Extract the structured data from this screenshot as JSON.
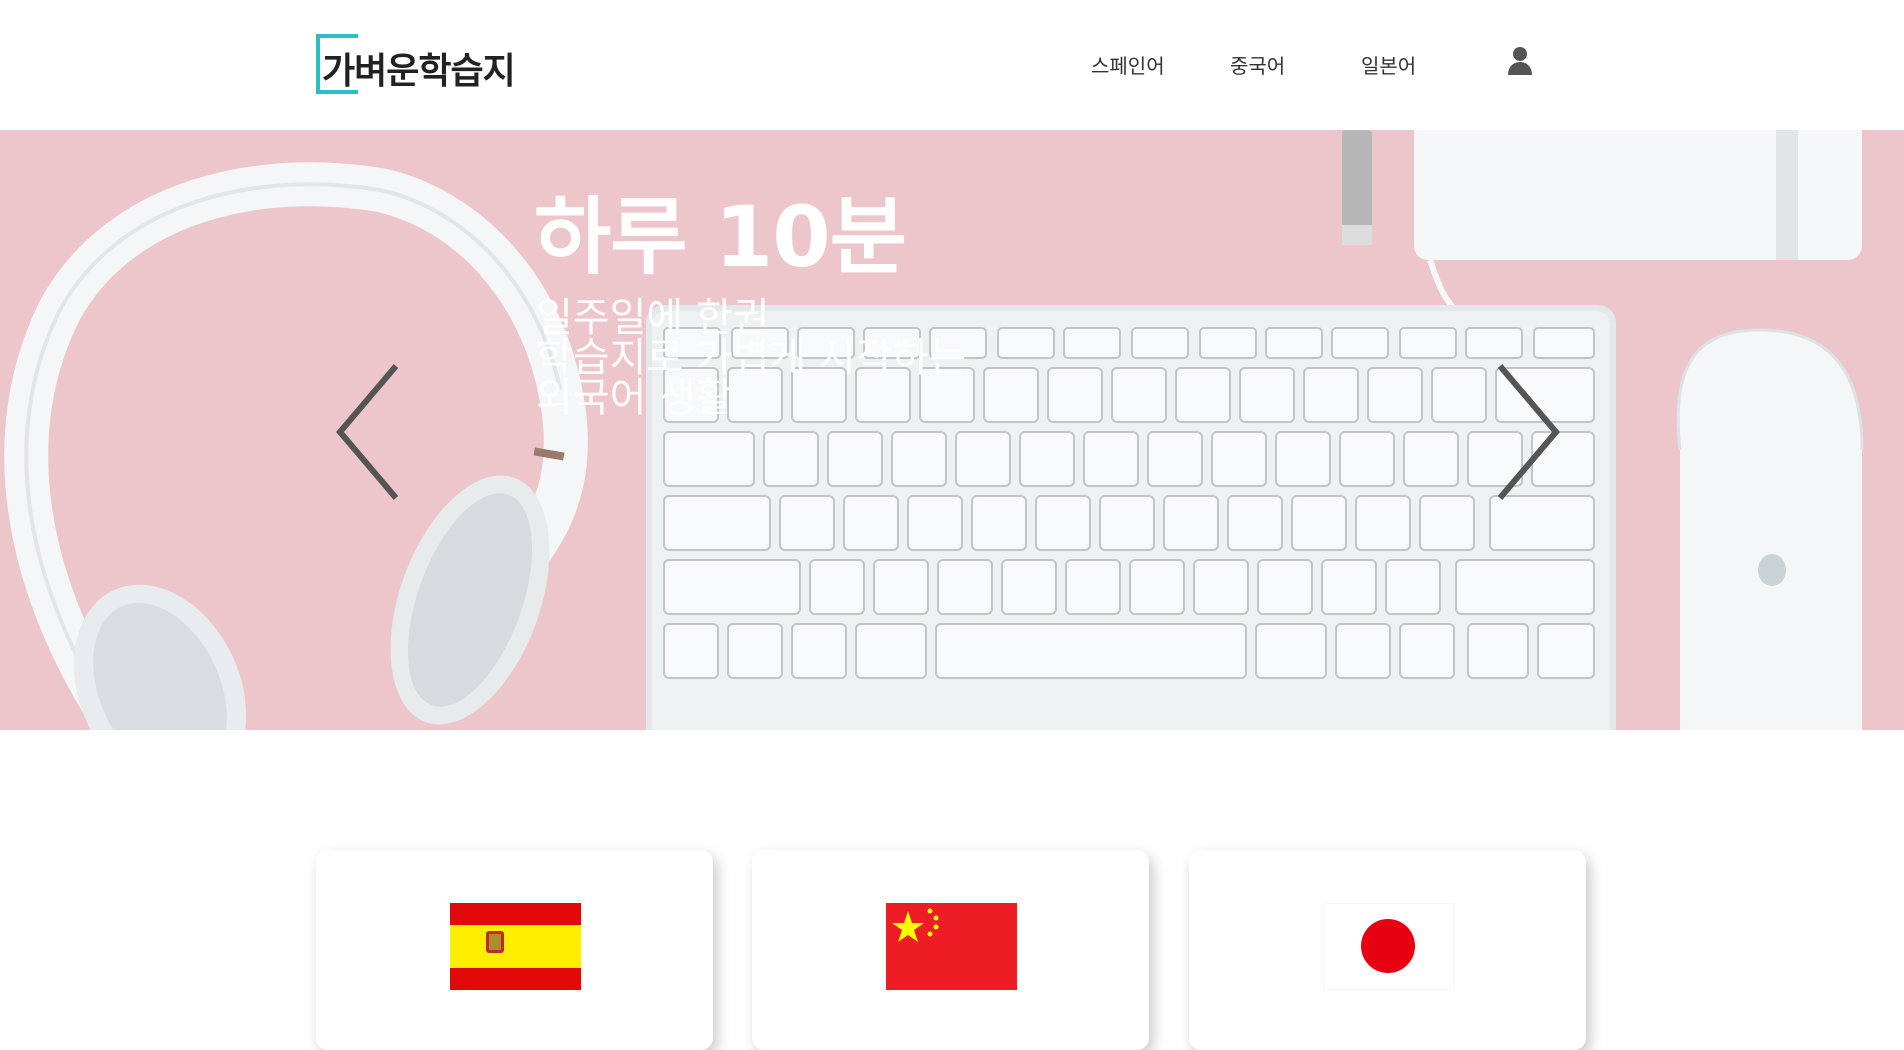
{
  "header": {
    "logo": "가벼운학습지",
    "nav": [
      "스페인어",
      "중국어",
      "일본어"
    ],
    "user_icon": "user-icon"
  },
  "hero": {
    "title": "하루 10분",
    "subtitle_lines": [
      "일주일에 한권",
      "학습지로 가볍게 시작하는",
      "외국어 생활"
    ],
    "prev_icon": "chevron-left-icon",
    "next_icon": "chevron-right-icon"
  },
  "cards": [
    {
      "flag": "spain-flag-icon"
    },
    {
      "flag": "china-flag-icon"
    },
    {
      "flag": "japan-flag-icon"
    }
  ],
  "colors": {
    "accent": "#2cbfc2",
    "hero_background": "#edc6cc"
  }
}
